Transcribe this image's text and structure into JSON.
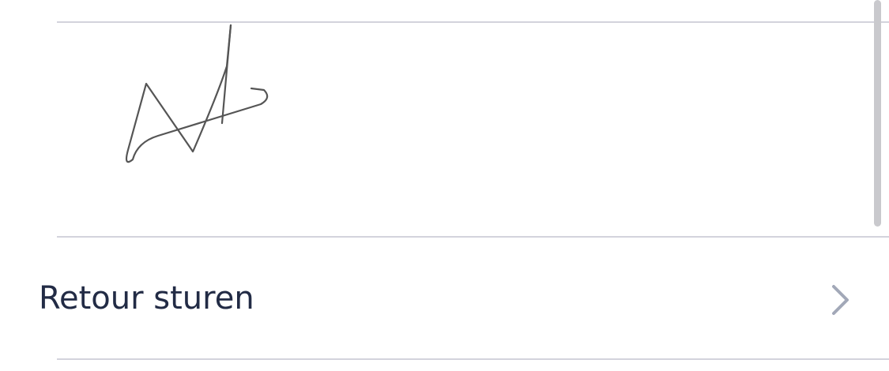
{
  "return_row": {
    "label": "Retour sturen",
    "chevron_icon": "chevron-right-icon"
  },
  "colors": {
    "divider": "#d3d3dc",
    "label_text": "#222b45",
    "chevron": "#a2a8b8",
    "signature_stroke": "#555555",
    "scrollbar": "#c9c9cd"
  }
}
